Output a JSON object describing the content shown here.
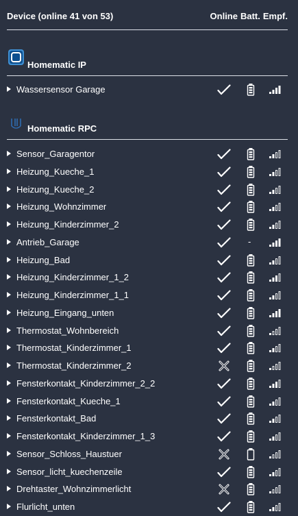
{
  "header": {
    "title": "Device (online 41 von 53)",
    "col_online": "Online",
    "col_batt": "Batt.",
    "col_empf": "Empf."
  },
  "groups": [
    {
      "title": "Homematic IP",
      "icon": "homematic-ip-logo-icon",
      "devices": [
        {
          "name": "Wassersensor Garage",
          "online": true,
          "battery": "full",
          "signal": 4
        }
      ]
    },
    {
      "title": "Homematic RPC",
      "icon": "homematic-rpc-logo-icon",
      "devices": [
        {
          "name": "Sensor_Garagentor",
          "online": true,
          "battery": "full",
          "signal": 2
        },
        {
          "name": "Heizung_Kueche_1",
          "online": true,
          "battery": "full",
          "signal": 2
        },
        {
          "name": "Heizung_Kueche_2",
          "online": true,
          "battery": "full",
          "signal": 2
        },
        {
          "name": "Heizung_Wohnzimmer",
          "online": true,
          "battery": "full",
          "signal": 2
        },
        {
          "name": "Heizung_Kinderzimmer_2",
          "online": true,
          "battery": "full",
          "signal": 2
        },
        {
          "name": "Antrieb_Garage",
          "online": true,
          "battery": "-",
          "signal": 4
        },
        {
          "name": "Heizung_Bad",
          "online": true,
          "battery": "full",
          "signal": 2
        },
        {
          "name": "Heizung_Kinderzimmer_1_2",
          "online": true,
          "battery": "full",
          "signal": 3
        },
        {
          "name": "Heizung_Kinderzimmer_1_1",
          "online": true,
          "battery": "full",
          "signal": 2
        },
        {
          "name": "Heizung_Eingang_unten",
          "online": true,
          "battery": "full",
          "signal": 4
        },
        {
          "name": "Thermostat_Wohnbereich",
          "online": true,
          "battery": "full",
          "signal": 1
        },
        {
          "name": "Thermostat_Kinderzimmer_1",
          "online": true,
          "battery": "full",
          "signal": 2
        },
        {
          "name": "Thermostat_Kinderzimmer_2",
          "online": false,
          "battery": "full",
          "signal": 1
        },
        {
          "name": "Fensterkontakt_Kinderzimmer_2_2",
          "online": true,
          "battery": "full",
          "signal": 3
        },
        {
          "name": "Fensterkontakt_Kueche_1",
          "online": true,
          "battery": "full",
          "signal": 2
        },
        {
          "name": "Fensterkontakt_Bad",
          "online": true,
          "battery": "full",
          "signal": 2
        },
        {
          "name": "Fensterkontakt_Kinderzimmer_1_3",
          "online": true,
          "battery": "full",
          "signal": 2
        },
        {
          "name": "Sensor_Schloss_Haustuer",
          "online": false,
          "battery": "empty",
          "signal": 1
        },
        {
          "name": "Sensor_licht_kuechenzeile",
          "online": true,
          "battery": "full",
          "signal": 2
        },
        {
          "name": "Drehtaster_Wohnzimmerlicht",
          "online": false,
          "battery": "full",
          "signal": 1
        },
        {
          "name": "Flurlicht_unten",
          "online": true,
          "battery": "full",
          "signal": 2
        }
      ]
    }
  ]
}
